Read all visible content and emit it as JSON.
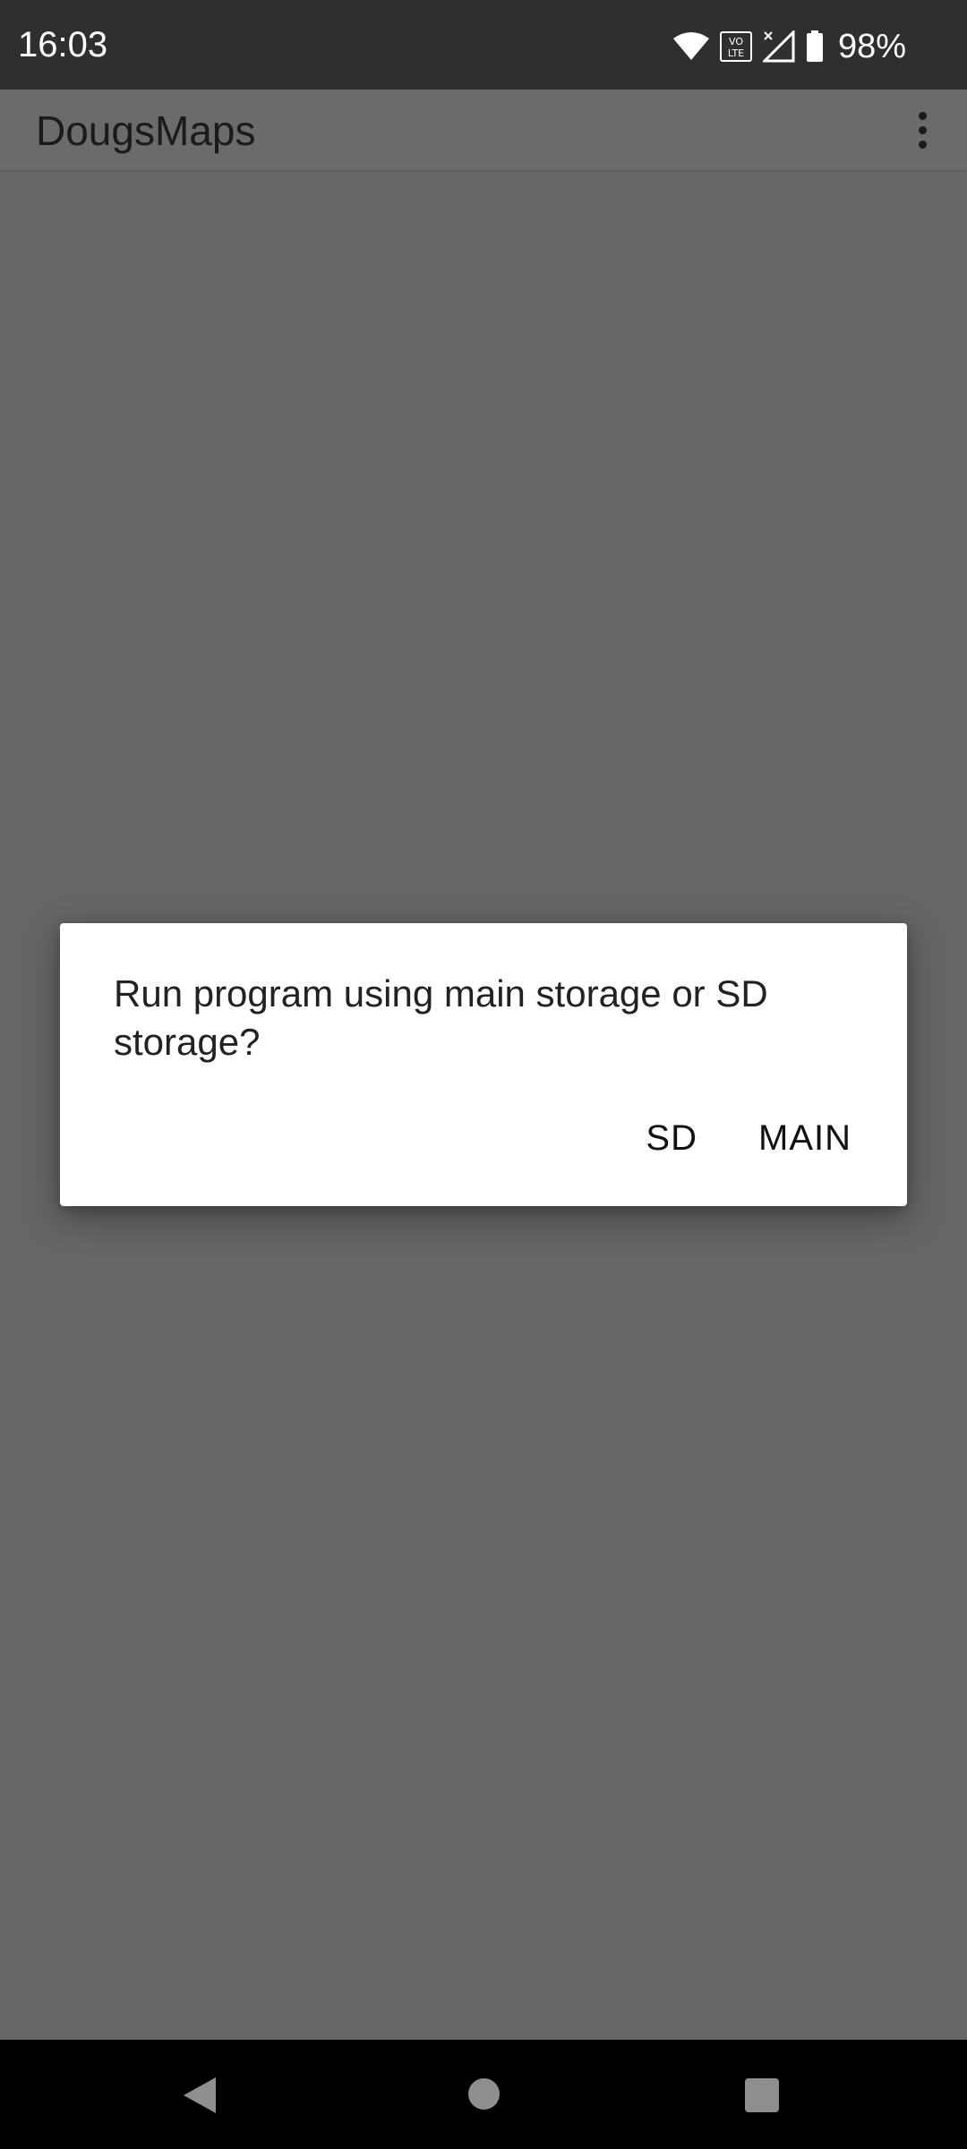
{
  "status_bar": {
    "time": "16:03",
    "battery_percent": "98%",
    "volte_label_top": "VO",
    "volte_label_bottom": "LTE"
  },
  "app_bar": {
    "title": "DougsMaps"
  },
  "dialog": {
    "message": "Run program using main storage or SD storage?",
    "buttons": {
      "sd": "SD",
      "main": "MAIN"
    }
  }
}
